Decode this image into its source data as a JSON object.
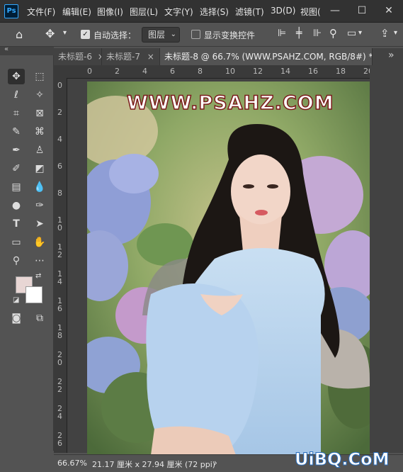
{
  "app": {
    "logo": "Ps"
  },
  "menu": [
    "文件(F)",
    "编辑(E)",
    "图像(I)",
    "图层(L)",
    "文字(Y)",
    "选择(S)",
    "滤镜(T)",
    "3D(D)",
    "视图("
  ],
  "window_controls": {
    "minimize": "—",
    "maximize": "☐",
    "close": "✕"
  },
  "options": {
    "auto_select_label": "自动选择：",
    "auto_select_value": "图层",
    "show_transform_label": "显示变换控件"
  },
  "tabs": [
    {
      "label": "未标题-6",
      "close": "×"
    },
    {
      "label": "未标题-7",
      "close": "×"
    },
    {
      "label": "未标题-8 @ 66.7% (WWW.PSAHZ.COM, RGB/8#) *",
      "close": "×",
      "active": true
    }
  ],
  "tabs_overflow": "»",
  "ruler": {
    "h": [
      "0",
      "2",
      "4",
      "6",
      "8",
      "10",
      "12",
      "14",
      "16",
      "18",
      "20",
      "2"
    ],
    "v": [
      "0",
      "2",
      "4",
      "6",
      "8",
      "1\n0",
      "1\n2",
      "1\n4",
      "1\n6",
      "1\n8",
      "2\n0",
      "2\n2",
      "2\n4",
      "2\n6"
    ]
  },
  "canvas": {
    "text_layer": "WWW.PSAHZ.COM"
  },
  "colors": {
    "foreground": "#e8d6d4",
    "background": "#ffffff"
  },
  "status": {
    "zoom": "66.67%",
    "doc_size": "21.17 厘米 x 27.94 厘米 (72 ppi)",
    "arrow": "›"
  },
  "watermark": "UiBQ.CoM"
}
